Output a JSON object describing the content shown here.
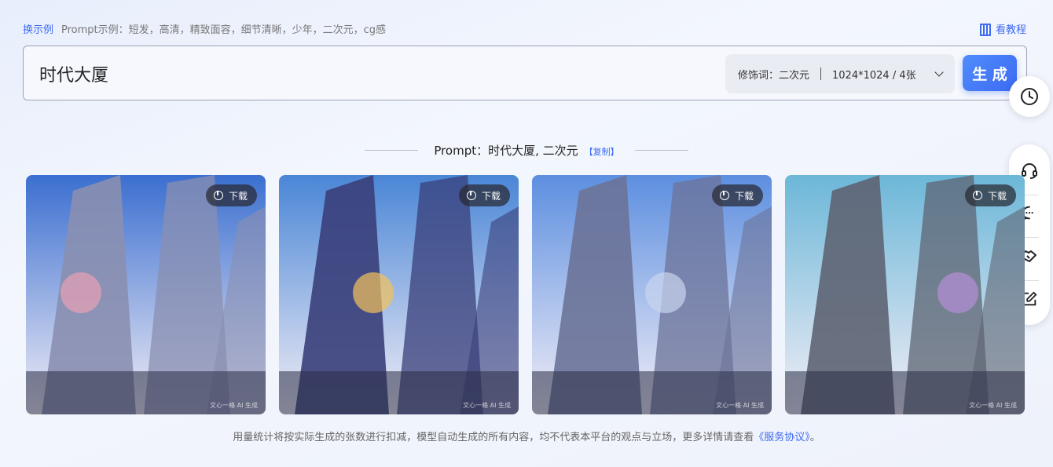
{
  "top": {
    "swap_label": "换示例",
    "examples_text": "Prompt示例：短发，高清，精致面容，细节清晰，少年，二次元，cg感",
    "tutorial_label": "看教程"
  },
  "search": {
    "value": "时代大厦",
    "modifier_label": "修饰词：二次元",
    "size_label": "1024*1024 / 4张",
    "generate_label": "生 成"
  },
  "result": {
    "prompt_text": "Prompt：时代大厦, 二次元",
    "copy_label": "【复制】",
    "images": [
      {
        "download_label": "下载",
        "sky": "#3b6fd0",
        "main": "#8a8fb0",
        "accent": "#e8a1b5"
      },
      {
        "download_label": "下载",
        "sky": "#4a86d6",
        "main": "#3a3f7a",
        "accent": "#f4c25a"
      },
      {
        "download_label": "下载",
        "sky": "#5d8fe0",
        "main": "#6c7398",
        "accent": "#c9d4ee"
      },
      {
        "download_label": "下载",
        "sky": "#6cb7d8",
        "main": "#5e6473",
        "accent": "#b58fd6"
      }
    ],
    "watermark": "文心一格 AI 生成"
  },
  "footer": {
    "text": "用量统计将按实际生成的张数进行扣减，模型自动生成的所有内容，均不代表本平台的观点与立场，更多详情请查看",
    "agreement_label": "《服务协议》",
    "end": "。"
  },
  "icons": {
    "history": "clock-icon",
    "tools": [
      "headset-icon",
      "chat-icon",
      "handshake-icon",
      "edit-icon"
    ]
  }
}
